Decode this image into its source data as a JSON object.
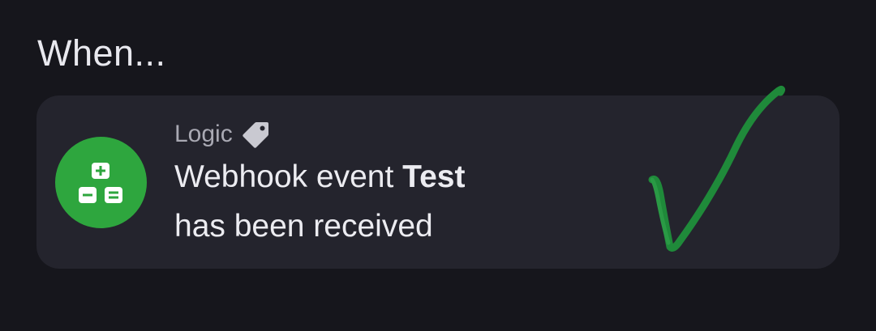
{
  "section": {
    "heading": "When..."
  },
  "trigger": {
    "category": "Logic",
    "title_prefix": "Webhook event ",
    "title_bold": "Test",
    "subtitle": "has been received",
    "icon": "calculator-icon",
    "category_icon": "tag-icon",
    "icon_color": "#2ea63e"
  },
  "annotation": {
    "type": "hand-drawn-checkmark-icon",
    "color": "#1f8a3a"
  }
}
